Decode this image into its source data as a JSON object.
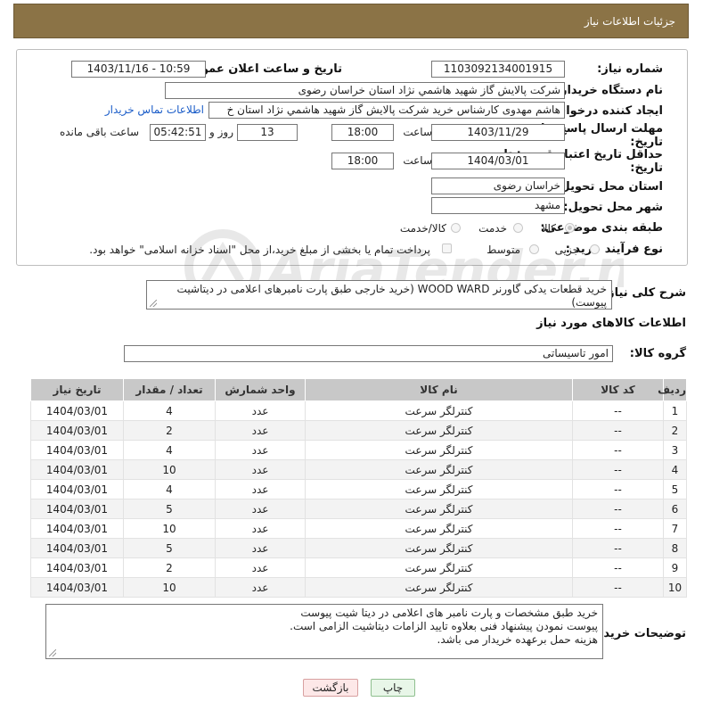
{
  "header": {
    "title": "جزئیات اطلاعات نیاز"
  },
  "form": {
    "need_number_label": "شماره نیاز:",
    "need_number": "1103092134001915",
    "announce_label": "تاریخ و ساعت اعلان عمومی:",
    "announce_value": "1403/11/16 - 10:59",
    "buyer_org_label": "نام دستگاه خریدار:",
    "buyer_org": "شرکت پالايش گاز شهيد هاشمي نژاد   استان خراسان رضوی",
    "creator_label": "ایجاد کننده درخواست:",
    "creator": "هاشم مهدوی کارشناس خرید شرکت پالايش گاز شهيد هاشمي نژاد   استان خ",
    "contact_link": "اطلاعات تماس خریدار",
    "deadline_label_1": "مهلت ارسال پاسخ: تا",
    "deadline_label_2": "تاریخ:",
    "deadline_date": "1403/11/29",
    "time_label": "ساعت",
    "deadline_time": "18:00",
    "days_value": "13",
    "days_label": "روز و",
    "remaining_time": "05:42:51",
    "remaining_label": "ساعت باقی مانده",
    "validity_label_1": "حداقل تاریخ اعتبار قیمت: تا",
    "validity_label_2": "تاریخ:",
    "validity_date": "1404/03/01",
    "validity_time_label": "ساعت",
    "validity_time": "18:00",
    "province_label": "استان محل تحویل:",
    "province": "خراسان رضوی",
    "city_label": "شهر محل تحویل:",
    "city": "مشهد",
    "category_label": "طبقه بندی موضوعی:",
    "category_options": [
      "کالا",
      "خدمت",
      "کالا/خدمت"
    ],
    "process_label": "نوع فرآیند خرید :",
    "process_options": [
      "جزیی",
      "متوسط"
    ],
    "payment_note": "پرداخت تمام یا بخشی از مبلغ خرید،از محل \"اسناد خزانه اسلامی\" خواهد بود."
  },
  "description": {
    "label": "شرح کلی نیاز:",
    "text": "خرید قطعات یدکی گاورنر WOOD WARD (خرید خارجی طبق پارت نامبرهای اعلامی در دیتاشیت پیوست)"
  },
  "goods_section": {
    "title": "اطلاعات کالاهای مورد نیاز",
    "group_label": "گروه کالا:",
    "group_value": "امور تاسیساتی"
  },
  "table": {
    "columns": [
      "ردیف",
      "کد کالا",
      "نام کالا",
      "واحد شمارش",
      "تعداد / مقدار",
      "تاریخ نیاز"
    ],
    "rows": [
      [
        "1",
        "--",
        "کنترلگر سرعت",
        "عدد",
        "4",
        "1404/03/01"
      ],
      [
        "2",
        "--",
        "کنترلگر سرعت",
        "عدد",
        "2",
        "1404/03/01"
      ],
      [
        "3",
        "--",
        "کنترلگر سرعت",
        "عدد",
        "4",
        "1404/03/01"
      ],
      [
        "4",
        "--",
        "کنترلگر سرعت",
        "عدد",
        "10",
        "1404/03/01"
      ],
      [
        "5",
        "--",
        "کنترلگر سرعت",
        "عدد",
        "4",
        "1404/03/01"
      ],
      [
        "6",
        "--",
        "کنترلگر سرعت",
        "عدد",
        "5",
        "1404/03/01"
      ],
      [
        "7",
        "--",
        "کنترلگر سرعت",
        "عدد",
        "10",
        "1404/03/01"
      ],
      [
        "8",
        "--",
        "کنترلگر سرعت",
        "عدد",
        "5",
        "1404/03/01"
      ],
      [
        "9",
        "--",
        "کنترلگر سرعت",
        "عدد",
        "2",
        "1404/03/01"
      ],
      [
        "10",
        "--",
        "کنترلگر سرعت",
        "عدد",
        "10",
        "1404/03/01"
      ]
    ]
  },
  "buyer_notes": {
    "label": "توضیحات خریدار:",
    "line1": "خرید طبق مشخصات و پارت نامبر های اعلامی در دیتا شیت پیوست",
    "line2": "پیوست نمودن پیشنهاد فنی بعلاوه تایید الزامات دیتاشیت الزامی است.",
    "line3": "هزینه حمل برعهده خریدار می باشد."
  },
  "buttons": {
    "print": "چاپ",
    "back": "بازگشت"
  },
  "watermark": "AriaTender.net",
  "colors": {
    "header_bg": "#8b7346",
    "link": "#1a5cc8",
    "back_button_bg": "#fde8e8",
    "print_button_bg": "#e8f6e8"
  }
}
